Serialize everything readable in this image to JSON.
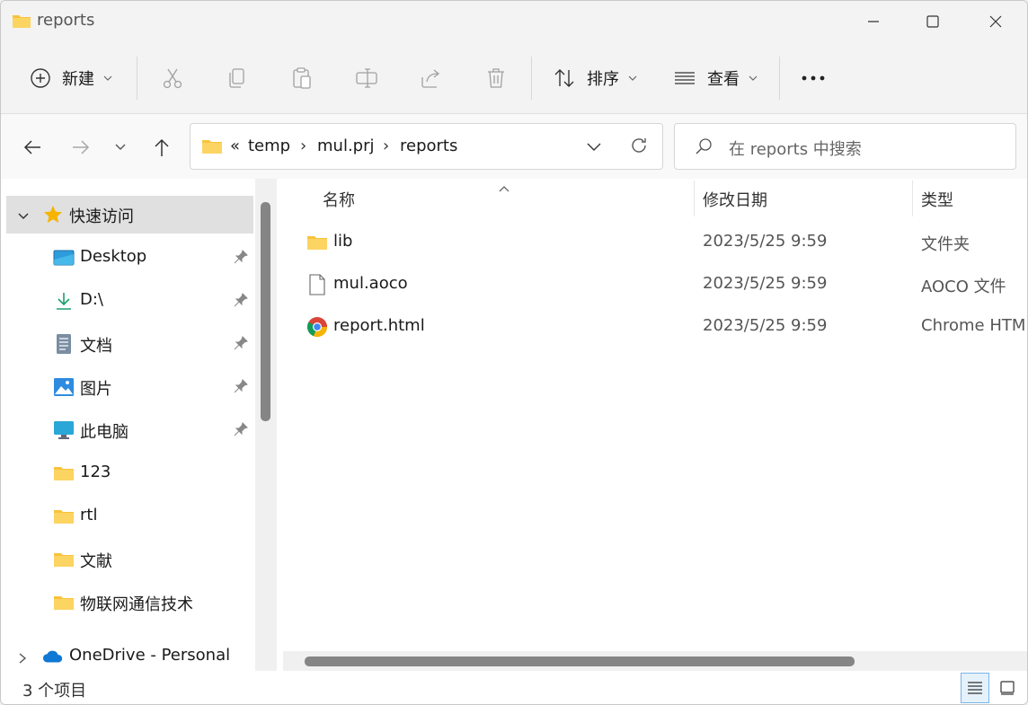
{
  "window": {
    "title": "reports"
  },
  "commandbar": {
    "new_label": "新建",
    "sort_label": "排序",
    "view_label": "查看",
    "more_label": "•••"
  },
  "address": {
    "overflow": "«",
    "crumbs": [
      "temp",
      "mul.prj",
      "reports"
    ],
    "separator": "›"
  },
  "search": {
    "placeholder": "在 reports 中搜索"
  },
  "nav": {
    "quick_access": "快速访问",
    "items": [
      {
        "label": "Desktop",
        "icon": "desktop-icon",
        "pinned": true
      },
      {
        "label": "D:\\",
        "icon": "download-arrow-icon",
        "pinned": true
      },
      {
        "label": "文档",
        "icon": "document-icon",
        "pinned": true
      },
      {
        "label": "图片",
        "icon": "picture-icon",
        "pinned": true
      },
      {
        "label": "此电脑",
        "icon": "computer-icon",
        "pinned": true
      },
      {
        "label": "123",
        "icon": "folder-icon",
        "pinned": false
      },
      {
        "label": "rtl",
        "icon": "folder-icon",
        "pinned": false
      },
      {
        "label": "文献",
        "icon": "folder-icon",
        "pinned": false
      },
      {
        "label": "物联网通信技术",
        "icon": "folder-icon",
        "pinned": false
      }
    ],
    "onedrive": "OneDrive - Personal"
  },
  "columns": {
    "name": "名称",
    "modified": "修改日期",
    "type": "类型"
  },
  "files": [
    {
      "name": "lib",
      "date": "2023/5/25 9:59",
      "type": "文件夹",
      "icon": "folder-icon"
    },
    {
      "name": "mul.aoco",
      "date": "2023/5/25 9:59",
      "type": "AOCO 文件",
      "icon": "file-icon"
    },
    {
      "name": "report.html",
      "date": "2023/5/25 9:59",
      "type": "Chrome HTML",
      "icon": "chrome-icon"
    }
  ],
  "status": {
    "count_text": "3 个项目"
  },
  "colors": {
    "accent": "#0067c0",
    "folder": "#f8c33c",
    "selection": "#e0e0e0"
  }
}
